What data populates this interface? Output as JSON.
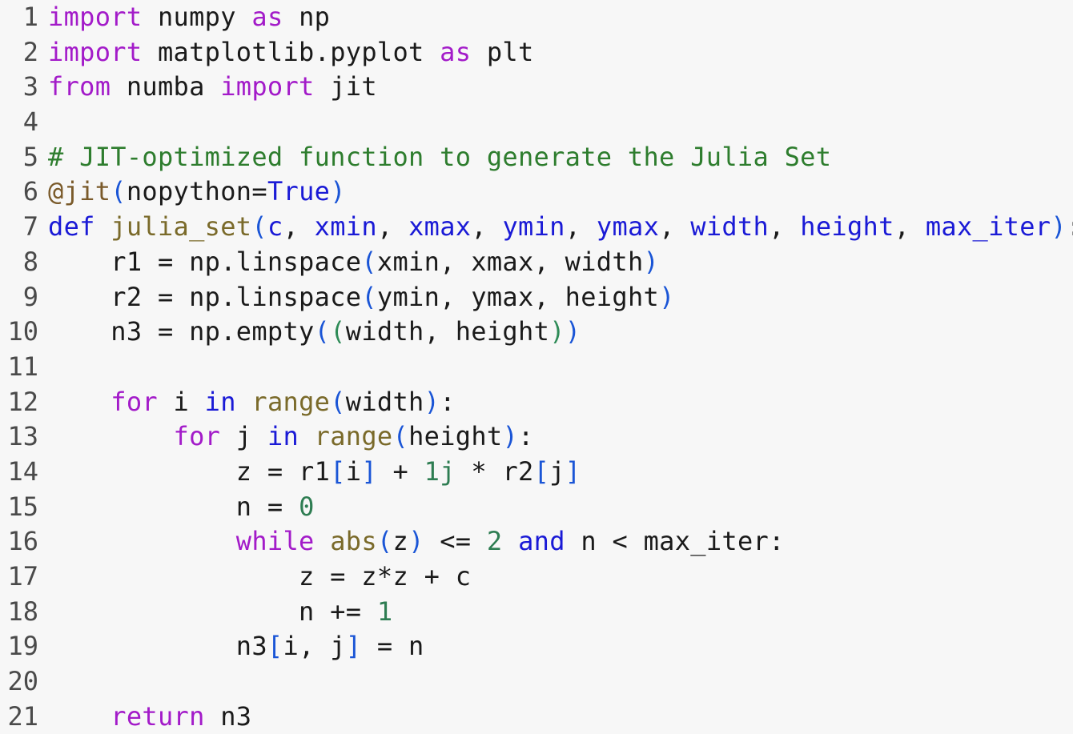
{
  "editor": {
    "lines": [
      {
        "n": "1",
        "tokens": [
          {
            "t": "import",
            "k": "kw"
          },
          {
            "t": " numpy ",
            "k": "plain"
          },
          {
            "t": "as",
            "k": "kw"
          },
          {
            "t": " np",
            "k": "plain"
          }
        ]
      },
      {
        "n": "2",
        "tokens": [
          {
            "t": "import",
            "k": "kw"
          },
          {
            "t": " matplotlib.pyplot ",
            "k": "plain"
          },
          {
            "t": "as",
            "k": "kw"
          },
          {
            "t": " plt",
            "k": "plain"
          }
        ]
      },
      {
        "n": "3",
        "tokens": [
          {
            "t": "from",
            "k": "kw"
          },
          {
            "t": " numba ",
            "k": "plain"
          },
          {
            "t": "import",
            "k": "kw"
          },
          {
            "t": " jit",
            "k": "plain"
          }
        ]
      },
      {
        "n": "4",
        "tokens": []
      },
      {
        "n": "5",
        "tokens": [
          {
            "t": "# JIT-optimized function to generate the Julia Set",
            "k": "cm"
          }
        ]
      },
      {
        "n": "6",
        "tokens": [
          {
            "t": "@jit",
            "k": "dec"
          },
          {
            "t": "(",
            "k": "br"
          },
          {
            "t": "nopython=",
            "k": "plain"
          },
          {
            "t": "True",
            "k": "const"
          },
          {
            "t": ")",
            "k": "br"
          }
        ]
      },
      {
        "n": "7",
        "tokens": [
          {
            "t": "def",
            "k": "kw2"
          },
          {
            "t": " ",
            "k": "plain"
          },
          {
            "t": "julia_set",
            "k": "fn"
          },
          {
            "t": "(",
            "k": "br"
          },
          {
            "t": "c",
            "k": "param"
          },
          {
            "t": ", ",
            "k": "plain"
          },
          {
            "t": "xmin",
            "k": "param"
          },
          {
            "t": ", ",
            "k": "plain"
          },
          {
            "t": "xmax",
            "k": "param"
          },
          {
            "t": ", ",
            "k": "plain"
          },
          {
            "t": "ymin",
            "k": "param"
          },
          {
            "t": ", ",
            "k": "plain"
          },
          {
            "t": "ymax",
            "k": "param"
          },
          {
            "t": ", ",
            "k": "plain"
          },
          {
            "t": "width",
            "k": "param"
          },
          {
            "t": ", ",
            "k": "plain"
          },
          {
            "t": "height",
            "k": "param"
          },
          {
            "t": ", ",
            "k": "plain"
          },
          {
            "t": "max_iter",
            "k": "param"
          },
          {
            "t": ")",
            "k": "br"
          },
          {
            "t": ":",
            "k": "plain"
          }
        ]
      },
      {
        "n": "8",
        "tokens": [
          {
            "t": "    r1 = np.linspace",
            "k": "plain"
          },
          {
            "t": "(",
            "k": "br"
          },
          {
            "t": "xmin, xmax, width",
            "k": "plain"
          },
          {
            "t": ")",
            "k": "br"
          }
        ]
      },
      {
        "n": "9",
        "tokens": [
          {
            "t": "    r2 = np.linspace",
            "k": "plain"
          },
          {
            "t": "(",
            "k": "br"
          },
          {
            "t": "ymin, ymax, height",
            "k": "plain"
          },
          {
            "t": ")",
            "k": "br"
          }
        ]
      },
      {
        "n": "10",
        "tokens": [
          {
            "t": "    n3 = np.empty",
            "k": "plain"
          },
          {
            "t": "(",
            "k": "br"
          },
          {
            "t": "(",
            "k": "br2"
          },
          {
            "t": "width, height",
            "k": "plain"
          },
          {
            "t": ")",
            "k": "br2"
          },
          {
            "t": ")",
            "k": "br"
          }
        ]
      },
      {
        "n": "11",
        "tokens": []
      },
      {
        "n": "12",
        "tokens": [
          {
            "t": "    ",
            "k": "plain"
          },
          {
            "t": "for",
            "k": "kw"
          },
          {
            "t": " i ",
            "k": "plain"
          },
          {
            "t": "in",
            "k": "kw2"
          },
          {
            "t": " ",
            "k": "plain"
          },
          {
            "t": "range",
            "k": "bi"
          },
          {
            "t": "(",
            "k": "br"
          },
          {
            "t": "width",
            "k": "plain"
          },
          {
            "t": ")",
            "k": "br"
          },
          {
            "t": ":",
            "k": "plain"
          }
        ]
      },
      {
        "n": "13",
        "tokens": [
          {
            "t": "        ",
            "k": "plain"
          },
          {
            "t": "for",
            "k": "kw"
          },
          {
            "t": " j ",
            "k": "plain"
          },
          {
            "t": "in",
            "k": "kw2"
          },
          {
            "t": " ",
            "k": "plain"
          },
          {
            "t": "range",
            "k": "bi"
          },
          {
            "t": "(",
            "k": "br"
          },
          {
            "t": "height",
            "k": "plain"
          },
          {
            "t": ")",
            "k": "br"
          },
          {
            "t": ":",
            "k": "plain"
          }
        ]
      },
      {
        "n": "14",
        "tokens": [
          {
            "t": "            z = r1",
            "k": "plain"
          },
          {
            "t": "[",
            "k": "br"
          },
          {
            "t": "i",
            "k": "plain"
          },
          {
            "t": "]",
            "k": "br"
          },
          {
            "t": " + ",
            "k": "plain"
          },
          {
            "t": "1j",
            "k": "num"
          },
          {
            "t": " * r2",
            "k": "plain"
          },
          {
            "t": "[",
            "k": "br"
          },
          {
            "t": "j",
            "k": "plain"
          },
          {
            "t": "]",
            "k": "br"
          }
        ]
      },
      {
        "n": "15",
        "tokens": [
          {
            "t": "            n = ",
            "k": "plain"
          },
          {
            "t": "0",
            "k": "num"
          }
        ]
      },
      {
        "n": "16",
        "tokens": [
          {
            "t": "            ",
            "k": "plain"
          },
          {
            "t": "while",
            "k": "kw"
          },
          {
            "t": " ",
            "k": "plain"
          },
          {
            "t": "abs",
            "k": "bi"
          },
          {
            "t": "(",
            "k": "br"
          },
          {
            "t": "z",
            "k": "plain"
          },
          {
            "t": ")",
            "k": "br"
          },
          {
            "t": " <= ",
            "k": "plain"
          },
          {
            "t": "2",
            "k": "num"
          },
          {
            "t": " ",
            "k": "plain"
          },
          {
            "t": "and",
            "k": "kw2"
          },
          {
            "t": " n < max_iter:",
            "k": "plain"
          }
        ]
      },
      {
        "n": "17",
        "tokens": [
          {
            "t": "                z = z*z + c",
            "k": "plain"
          }
        ]
      },
      {
        "n": "18",
        "tokens": [
          {
            "t": "                n += ",
            "k": "plain"
          },
          {
            "t": "1",
            "k": "num"
          }
        ]
      },
      {
        "n": "19",
        "tokens": [
          {
            "t": "            n3",
            "k": "plain"
          },
          {
            "t": "[",
            "k": "br"
          },
          {
            "t": "i, j",
            "k": "plain"
          },
          {
            "t": "]",
            "k": "br"
          },
          {
            "t": " = n",
            "k": "plain"
          }
        ]
      },
      {
        "n": "20",
        "tokens": []
      },
      {
        "n": "21",
        "tokens": [
          {
            "t": "    ",
            "k": "plain"
          },
          {
            "t": "return",
            "k": "kw"
          },
          {
            "t": " n3",
            "k": "plain"
          }
        ]
      }
    ]
  },
  "colors": {
    "background": "#f7f7f7",
    "keyword": "#a31bc9",
    "keyword_blue": "#1a1ad6",
    "comment": "#2e7d2e",
    "function_name": "#7a6a2a",
    "number": "#2e7d52",
    "bracket": "#1a55d6",
    "line_number": "#4a4a4a"
  }
}
